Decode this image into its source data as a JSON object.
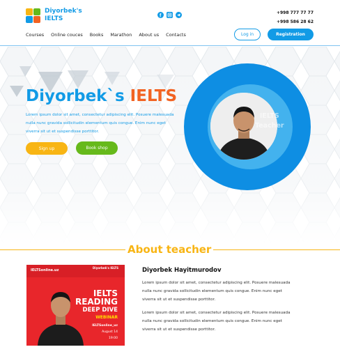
{
  "header": {
    "logo": {
      "line1": "Diyorbek's",
      "line2": "IELTS",
      "tiles": [
        "#f8b514",
        "#66b91b",
        "#129be6",
        "#f26322"
      ]
    },
    "social_icons": [
      "facebook-icon",
      "instagram-icon",
      "telegram-icon"
    ],
    "phones": [
      "+998 777 77 77",
      "+998 586 28 62"
    ],
    "nav": [
      "Courses",
      "Online couces",
      "Books",
      "Marathon",
      "About us",
      "Contacts"
    ],
    "login_label": "Log in",
    "register_label": "Registration"
  },
  "hero": {
    "title_main": "Diyorbek`s ",
    "title_accent": "IELTS",
    "description": "Lorem ipsum dolor sit amet, consectetur adipiscing elit. Posuere malesuada nulla nunc gravida sollicitudin elementum quis congue. Enim nunc eget viverra sit ut et suspendisse porttitor.",
    "signup_label": "Sign up",
    "bookshop_label": "Book shop",
    "ring_text_1": "IELTS",
    "ring_text_2": "Teacher"
  },
  "about": {
    "title": "About teacher",
    "name": "Diyorbek Hayitmurodov",
    "paragraph_1": "Lorem ipsum dolor sit amet, consectetur adipiscing elit. Posuere malesuada nulla nunc gravida sollicitudin elementum quis congue. Enim nunc eget viverra sit ut et suspendisse porttitor.",
    "paragraph_2": "Lorem ipsum dolor sit amet, consectetur adipiscing elit. Posuere malesuada nulla nunc gravida sollicitudin elementum quis congue. Enim nunc eget viverra sit ut et suspendisse porttitor.",
    "poster": {
      "brand": "IELTSonline.uz",
      "brand2": "Diyorbek's IELTS",
      "line1": "IELTS",
      "line2": "READING",
      "line3": "DEEP DIVE",
      "line4": "WEBINAR",
      "site": "IELTSonline_uz",
      "date": "August 14",
      "time": "19:00"
    }
  },
  "colors": {
    "primary": "#129be6",
    "accent": "#f26322",
    "yellow": "#f8b514",
    "green": "#66b91b"
  }
}
